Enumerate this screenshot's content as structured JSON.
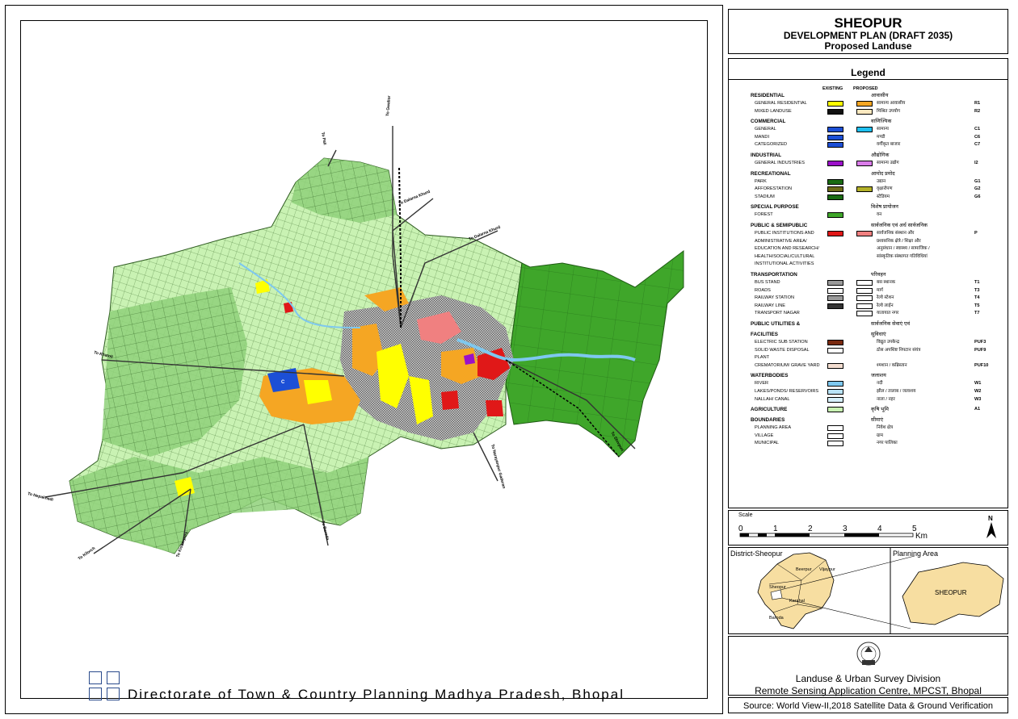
{
  "title": {
    "main": "SHEOPUR",
    "sub": "DEVELOPMENT PLAN (DRAFT 2035)",
    "sub2": "Proposed Landuse"
  },
  "legend": {
    "heading": "Legend",
    "col_existing": "EXISTING",
    "col_proposed": "PROPOSED",
    "rows": [
      {
        "type": "cat",
        "en": "RESIDENTIAL",
        "hi": "आवासीय"
      },
      {
        "type": "item",
        "en": "GENERAL RESIDENTIAL",
        "hi": "सामान्य आवासीय",
        "code": "R1",
        "ex": "#ffff00",
        "pr": "#f5a623"
      },
      {
        "type": "item",
        "en": "MIXED LANDUSE",
        "hi": "मिश्रित उपयोग",
        "code": "R2",
        "ex": "#111111",
        "pr": "#fde9c0"
      },
      {
        "type": "cat",
        "en": "COMMERCIAL",
        "hi": "वाणिज्यिक"
      },
      {
        "type": "item",
        "en": "GENERAL",
        "hi": "सामान्य",
        "code": "C1",
        "ex": "#1c4fd6",
        "pr": "#1ec0f0"
      },
      {
        "type": "item",
        "en": "MANDI",
        "hi": "मण्डी",
        "code": "C6",
        "ex": "#1c4fd6"
      },
      {
        "type": "item",
        "en": "CATEGORIZED",
        "hi": "वर्गीकृत बाजार",
        "code": "C7",
        "ex": "#1c4fd6"
      },
      {
        "type": "cat",
        "en": "INDUSTRIAL",
        "hi": "औद्योगिक"
      },
      {
        "type": "item",
        "en": "GENERAL INDUSTRIES",
        "hi": "सामान्य उद्योग",
        "code": "I2",
        "ex": "#9b10c8",
        "pr": "#d97ce8"
      },
      {
        "type": "cat",
        "en": "RECREATIONAL",
        "hi": "आमोद प्रमोद"
      },
      {
        "type": "item",
        "en": "PARK",
        "hi": "उद्यान",
        "code": "G1",
        "ex": "#1a6b12"
      },
      {
        "type": "item",
        "en": "AFFORESTATION",
        "hi": "वृक्षारोपण",
        "code": "G2",
        "ex": "#6d6b18",
        "pr": "#b3b128"
      },
      {
        "type": "item",
        "en": "STADIUM",
        "hi": "स्टेडियम",
        "code": "G6",
        "ex": "#1a6b12"
      },
      {
        "type": "cat",
        "en": "SPECIAL PURPOSE",
        "hi": "विशेष प्रायोजन"
      },
      {
        "type": "item",
        "en": "FOREST",
        "hi": "वन",
        "code": "",
        "ex": "#3fa62a"
      },
      {
        "type": "cat",
        "en": "PUBLIC & SEMIPUBLIC",
        "hi": "सार्वजनिक एवं अर्ध सार्वजनिक"
      },
      {
        "type": "item",
        "en": "PUBLIC INSTITUTIONS AND",
        "hi": "सार्वजनिक संस्थान और",
        "code": "P",
        "ex": "#e01818",
        "pr": "#f08080"
      },
      {
        "type": "item",
        "en": "ADMINISTRATIVE AREA/",
        "hi": "प्रशासनिक क्षेत्रे / शिक्षा और"
      },
      {
        "type": "item",
        "en": "EDUCATION AND RESEARCH/",
        "hi": "अनुसंधान / स्वास्थ्य / सामाजिक /"
      },
      {
        "type": "item",
        "en": "HEALTH/SOCIAL/CULTURAL",
        "hi": "सांस्कृतिक संस्थागत गतिविधियां"
      },
      {
        "type": "item",
        "en": "INSTITUTIONAL ACTIVITIES",
        "hi": ""
      },
      {
        "type": "cat",
        "en": "TRANSPORTATION",
        "hi": "परिवहन"
      },
      {
        "type": "item",
        "en": "BUS STAND",
        "hi": "बस स्थानक",
        "code": "T1",
        "ex": "#9a9a9a",
        "pr": "#ffffff"
      },
      {
        "type": "item",
        "en": "ROADS",
        "hi": "मार्ग",
        "code": "T3",
        "ex": "#ffffff",
        "pr": "#ffffff"
      },
      {
        "type": "item",
        "en": "RAILWAY STATION",
        "hi": "रेल्वे स्टेशन",
        "code": "T4",
        "ex": "#9a9a9a",
        "pr": "#ffffff"
      },
      {
        "type": "item",
        "en": "RAILWAY LINE",
        "hi": "रेल्वे लाईन",
        "code": "T5",
        "ex": "#333333",
        "pr": "#ffffff"
      },
      {
        "type": "item",
        "en": "TRANSPORT NAGAR",
        "hi": "यातायात नगर",
        "code": "T7",
        "pr": "#ffffff"
      },
      {
        "type": "cat",
        "en": "PUBLIC UTILITIES &",
        "hi": "सार्वजनिक सेवाएं एवं"
      },
      {
        "type": "cat",
        "en": "FACILITIES",
        "hi": "सुविधाएं"
      },
      {
        "type": "item",
        "en": "ELECTRIC SUB STATION",
        "hi": "विद्युत उपकेन्द्र",
        "code": "PUF3",
        "ex": "#7a2a10"
      },
      {
        "type": "item",
        "en": "SOLID WASTE DISPOSAL",
        "hi": "ठोस अपशिष्ट निपटान संयंत्र",
        "code": "PUF9",
        "ex": "#ffffff"
      },
      {
        "type": "item",
        "en": "PLANT",
        "hi": ""
      },
      {
        "type": "item",
        "en": "CREMATORIUM/ GRAVE YARD",
        "hi": "श्मशान / कब्रिस्तान",
        "code": "PUF10",
        "ex": "#f3ddd0"
      },
      {
        "type": "cat",
        "en": "WATERBODIES",
        "hi": "जलाशय"
      },
      {
        "type": "item",
        "en": "RIVER",
        "hi": "नदी",
        "code": "W1",
        "ex": "#7ec8ef"
      },
      {
        "type": "item",
        "en": "LAKES/PONDS/ RESERVOIRS",
        "hi": "झील / तालाब / जलाशय",
        "code": "W2",
        "ex": "#b9e3f7"
      },
      {
        "type": "item",
        "en": "NALLAH/ CANAL",
        "hi": "नाला / नहर",
        "code": "W3",
        "ex": "#d7f0fb"
      },
      {
        "type": "cat",
        "en": "AGRICULTURE",
        "hi": "कृषि भूमि",
        "code": "A1",
        "ex": "#c9f2b3"
      },
      {
        "type": "cat",
        "en": "BOUNDARIES",
        "hi": "सीमाएं"
      },
      {
        "type": "item",
        "en": "PLANNING AREA",
        "hi": "निवेश क्षेत्र",
        "ex": "#ffffff"
      },
      {
        "type": "item",
        "en": "VILLAGE",
        "hi": "ग्राम",
        "ex": "#ffffff"
      },
      {
        "type": "item",
        "en": "MUNICIPAL",
        "hi": "नगर पालिका",
        "ex": "#ffffff"
      }
    ]
  },
  "scale": {
    "title": "Scale",
    "ticks": [
      "0",
      "1",
      "2",
      "3",
      "4",
      "5"
    ],
    "unit": "Km",
    "north": "N"
  },
  "locator": {
    "district_title": "District-Sheopur",
    "planning_title": "Planning Area",
    "planning_label": "SHEOPUR",
    "places": [
      "Beerpur",
      "Vijaypur",
      "Sheopur",
      "Karahal",
      "Baroda"
    ]
  },
  "credit": {
    "line1": "Landuse & Urban Survey Division",
    "line2": "Remote Sensing Application Centre, MPCST, Bhopal"
  },
  "source": "Source: World View-II,2018 Satellite Data & Ground Verification",
  "footer": "Directorate of Town & Country Planning Madhya Pradesh, Bhopal",
  "map": {
    "road_labels": [
      "To Pali",
      "To Gwalior",
      "To Dalarna Khurd",
      "To Dalarna Khurd",
      "To Khatoli",
      "To Nepakhedi",
      "To Kilorch",
      "To Kisherpura",
      "To Baroda",
      "To Narayanpur Gaderan",
      "To Shivpuri"
    ],
    "colors": {
      "agri": "#c9f2b3",
      "village": "#8fd17a",
      "forest": "#3fa62a",
      "res_ex": "#ffff00",
      "res_pr": "#f5a623",
      "pub": "#e01818",
      "pub_pr": "#f08080",
      "com": "#1c4fd6",
      "river": "#7ec8ef"
    }
  }
}
